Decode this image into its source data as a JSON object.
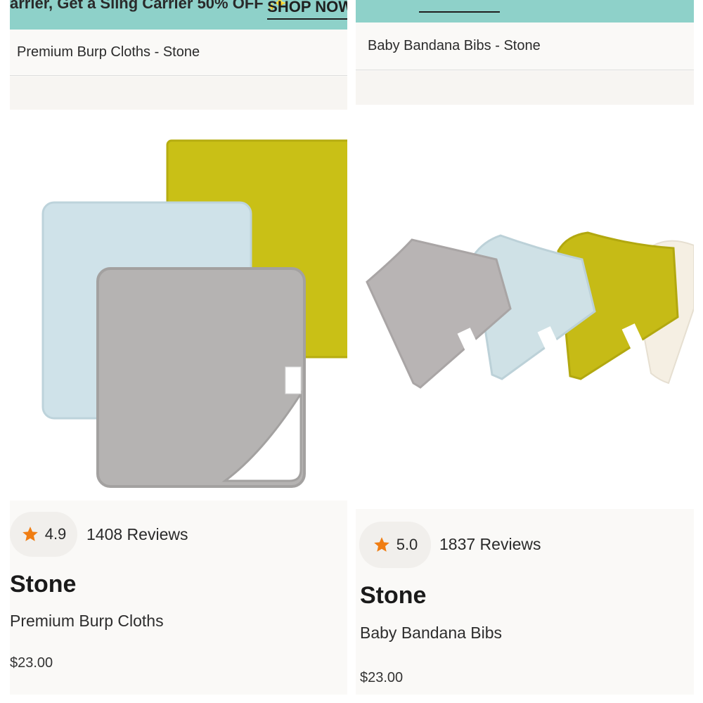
{
  "left_product": {
    "promo": {
      "text": "arrier, Get a Sling Carrier 50% OFF ✨",
      "link": "SHOP NOW"
    },
    "breadcrumb": "Premium Burp Cloths - Stone",
    "image": {
      "alt": "Premium Burp Cloths set: light blue, yellow and stone gray",
      "colors": [
        "#cfe2e9",
        "#c9c016",
        "#b5b3b2"
      ]
    },
    "rating": {
      "value": "4.9",
      "reviews": "1408 Reviews"
    },
    "color_name": "Stone",
    "product_name": "Premium Burp Cloths",
    "price": "$23.00"
  },
  "right_product": {
    "promo": {
      "text": "",
      "link": ""
    },
    "breadcrumb": "Baby Bandana Bibs - Stone",
    "image": {
      "alt": "Baby Bandana Bibs set: stone gray, light blue, yellow and cream",
      "colors": [
        "#b8b4b4",
        "#cfe1e6",
        "#c6bb16",
        "#f5efe3"
      ]
    },
    "rating": {
      "value": "5.0",
      "reviews": "1837 Reviews"
    },
    "color_name": "Stone",
    "product_name": "Baby Bandana Bibs",
    "price": "$23.00"
  },
  "theme": {
    "promo_bg": "#8ed1c9",
    "star_color": "#f07d12"
  }
}
